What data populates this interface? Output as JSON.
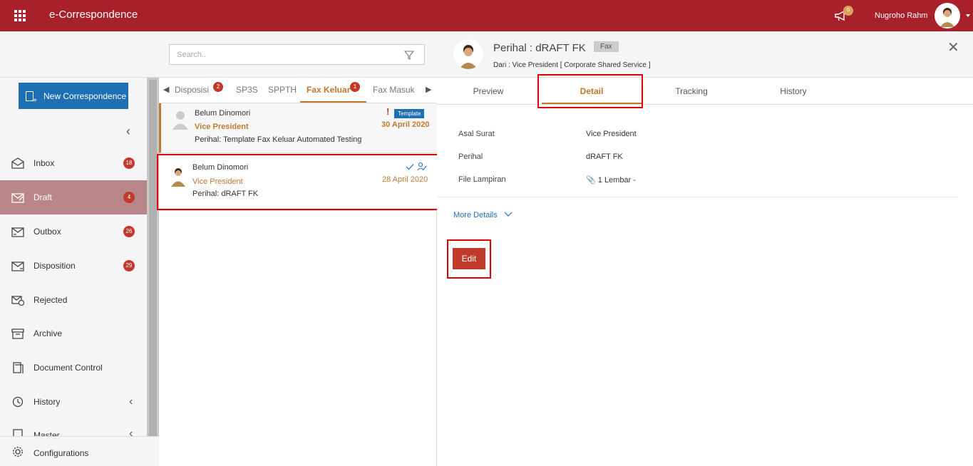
{
  "topbar": {
    "app_title": "e-Correspondence",
    "notif_count": "0",
    "user_name": "Nugroho Rahm"
  },
  "sidebar": {
    "new_button": "New Correspondence",
    "items": [
      {
        "label": "Inbox",
        "badge": "18",
        "icon": "inbox-icon"
      },
      {
        "label": "Draft",
        "badge": "4",
        "icon": "draft-icon"
      },
      {
        "label": "Outbox",
        "badge": "26",
        "icon": "outbox-icon"
      },
      {
        "label": "Disposition",
        "badge": "29",
        "icon": "disposition-icon"
      },
      {
        "label": "Rejected",
        "badge": "",
        "icon": "rejected-icon"
      },
      {
        "label": "Archive",
        "badge": "",
        "icon": "archive-icon"
      },
      {
        "label": "Document Control",
        "badge": "",
        "icon": "document-control-icon"
      },
      {
        "label": "History",
        "badge": "",
        "icon": "history-icon"
      },
      {
        "label": "Master",
        "badge": "",
        "icon": "master-icon"
      }
    ],
    "config_label": "Configurations"
  },
  "list": {
    "search_placeholder": "Search..",
    "tabs": [
      {
        "label": "Disposisi",
        "badge": "2"
      },
      {
        "label": "SP3S"
      },
      {
        "label": "SPPTH"
      },
      {
        "label": "Fax Keluar",
        "badge": "1"
      },
      {
        "label": "Fax Masuk"
      }
    ],
    "messages": [
      {
        "sender": "Belum Dinomori",
        "role": "Vice President",
        "subject": "Perihal: Template Fax Keluar Automated Testing",
        "date": "30 April 2020",
        "badge": "Template",
        "flag": "!"
      },
      {
        "sender": "Belum Dinomori",
        "role": "Vice President",
        "subject": "Perihal: dRAFT FK",
        "date": "28 April 2020"
      }
    ]
  },
  "detail": {
    "title": "Perihal : dRAFT FK",
    "type_badge": "Fax",
    "from": "Dari : Vice President [ Corporate Shared Service ]",
    "tabs": [
      "Preview",
      "Detail",
      "Tracking",
      "History"
    ],
    "rows": [
      {
        "label": "Asal Surat",
        "value": "Vice President"
      },
      {
        "label": "Perihal",
        "value": "dRAFT FK"
      },
      {
        "label": "File Lampiran",
        "value": "1 Lembar -"
      }
    ],
    "more_details": "More Details",
    "edit_label": "Edit"
  },
  "colors": {
    "brand": "#a8202a",
    "accent": "#c0782e",
    "primary_button": "#1f6fb5",
    "badge": "#c0392b"
  }
}
